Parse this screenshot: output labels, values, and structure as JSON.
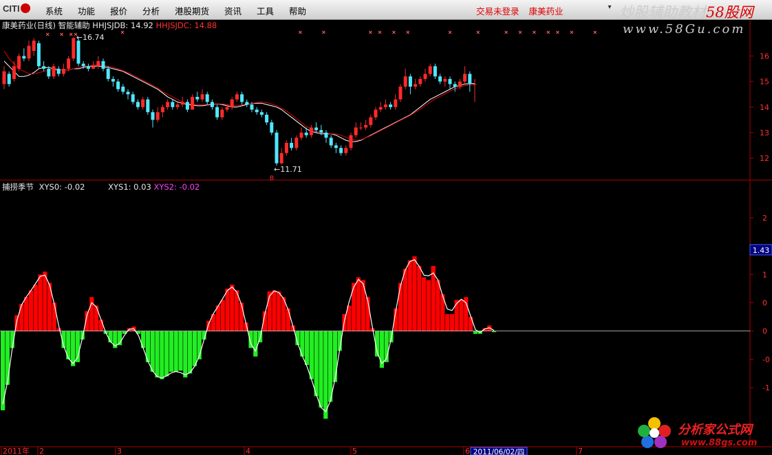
{
  "menubar": {
    "logo_text": "CITI",
    "items": [
      "系统",
      "功能",
      "报价",
      "分析",
      "港股期货",
      "资讯",
      "工具",
      "帮助"
    ],
    "status_login": "交易未登录",
    "status_stock": "康美药业",
    "minimize_label": "▾"
  },
  "watermarks": {
    "top_main": "炒股辅助教材",
    "top_accent": "58股网",
    "top_url": "www.58Gu.com",
    "bottom_main": "分析家公式网",
    "bottom_url": "www.88gs.com"
  },
  "price_panel": {
    "title": "康美药业(日线) 智能辅助",
    "line1_label": "HHJSJDB: 14.92",
    "line2_label": "HHJSJDC: 14.88",
    "high_label": "16.74",
    "low_label": "11.71",
    "low_mark": "B",
    "colors": {
      "up": "#ff2a2a",
      "down": "#50e8ff",
      "line1": "#ffffff",
      "line2": "#e00000"
    }
  },
  "indicator_panel": {
    "title": "捕捞季节",
    "xys0_label": "XYS0: -0.02",
    "xys1_label": "XYS1: 0.03",
    "xys2_label": "XYS2: -0.02",
    "cursor_value": "1.43",
    "colors": {
      "pos": "#ff0000",
      "neg": "#22ee22"
    }
  },
  "x_axis": {
    "labels": [
      "2011年",
      "2",
      "3",
      "4",
      "5",
      "6",
      "7"
    ],
    "cursor_date": "2011/06/02/四"
  },
  "chart_data": [
    {
      "type": "candlestick",
      "title": "康美药业(日线) 智能辅助",
      "y_ticks": [
        "16",
        "15",
        "14",
        "13",
        "12"
      ],
      "ylim": [
        11.6,
        16.9
      ],
      "series": [
        {
          "name": "HHJSJDB",
          "values": [
            15.8,
            15.6,
            15.4,
            15.2,
            15.2,
            15.25,
            15.35,
            15.5,
            15.55,
            15.55,
            15.5,
            15.45,
            15.45,
            15.45,
            15.5,
            15.5,
            15.55,
            15.6,
            15.6,
            15.6,
            15.58,
            15.55,
            15.5,
            15.45,
            15.4,
            15.3,
            15.2,
            15.1,
            15.0,
            14.9,
            14.8,
            14.7,
            14.55,
            14.4,
            14.3,
            14.2,
            14.15,
            14.1,
            14.08,
            14.05,
            14.05,
            14.08,
            14.1,
            14.12,
            14.1,
            14.05,
            14.0,
            14.0,
            14.05,
            14.1,
            14.15,
            14.15,
            14.15,
            14.1,
            14.05,
            14.0,
            13.9,
            13.75,
            13.6,
            13.45,
            13.3,
            13.15,
            13.05,
            13.0,
            12.95,
            12.95,
            12.95,
            12.9,
            12.8,
            12.7,
            12.65,
            12.65,
            12.7,
            12.8,
            12.9,
            13.0,
            13.1,
            13.2,
            13.3,
            13.4,
            13.5,
            13.6,
            13.7,
            13.85,
            14.0,
            14.15,
            14.3,
            14.4,
            14.5,
            14.6,
            14.7,
            14.8,
            14.85,
            14.9,
            14.92,
            14.92
          ]
        },
        {
          "name": "HHJSJDC",
          "values": [
            16.2,
            15.9,
            15.7,
            15.5,
            15.4,
            15.3,
            15.3,
            15.35,
            15.4,
            15.45,
            15.45,
            15.45,
            15.45,
            15.45,
            15.5,
            15.55,
            15.6,
            15.6,
            15.65,
            15.65,
            15.62,
            15.6,
            15.55,
            15.5,
            15.42,
            15.35,
            15.25,
            15.15,
            15.05,
            14.95,
            14.85,
            14.75,
            14.6,
            14.5,
            14.4,
            14.3,
            14.2,
            14.15,
            14.1,
            14.1,
            14.1,
            14.1,
            14.12,
            14.12,
            14.12,
            14.1,
            14.05,
            14.05,
            14.08,
            14.12,
            14.15,
            14.18,
            14.2,
            14.18,
            14.12,
            14.05,
            13.95,
            13.85,
            13.7,
            13.55,
            13.4,
            13.25,
            13.15,
            13.05,
            13.0,
            12.98,
            12.95,
            12.95,
            12.9,
            12.82,
            12.75,
            12.7,
            12.72,
            12.8,
            12.88,
            12.98,
            13.08,
            13.18,
            13.28,
            13.38,
            13.48,
            13.58,
            13.68,
            13.8,
            13.92,
            14.05,
            14.2,
            14.32,
            14.42,
            14.52,
            14.62,
            14.72,
            14.78,
            14.84,
            14.87,
            14.88
          ]
        }
      ],
      "candles": [
        [
          14.9,
          15.4,
          15.6,
          14.7
        ],
        [
          15.3,
          14.9,
          15.4,
          14.8
        ],
        [
          15.1,
          15.6,
          15.8,
          15.0
        ],
        [
          15.5,
          16.0,
          16.1,
          15.4
        ],
        [
          16.0,
          15.9,
          16.3,
          15.8
        ],
        [
          15.9,
          16.4,
          16.6,
          15.8
        ],
        [
          16.2,
          16.6,
          16.7,
          16.0
        ],
        [
          16.5,
          15.6,
          16.6,
          15.5
        ],
        [
          15.6,
          15.5,
          15.8,
          15.4
        ],
        [
          15.5,
          15.2,
          15.6,
          15.1
        ],
        [
          15.2,
          15.6,
          15.7,
          15.1
        ],
        [
          15.5,
          15.3,
          15.6,
          15.2
        ],
        [
          15.3,
          15.5,
          15.7,
          15.2
        ],
        [
          15.5,
          15.9,
          16.0,
          15.4
        ],
        [
          15.9,
          16.7,
          16.74,
          15.8
        ],
        [
          16.6,
          15.7,
          16.7,
          15.6
        ],
        [
          15.7,
          15.6,
          15.8,
          15.5
        ],
        [
          15.6,
          15.5,
          15.7,
          15.4
        ],
        [
          15.5,
          15.6,
          15.8,
          15.5
        ],
        [
          15.6,
          15.8,
          16.0,
          15.5
        ],
        [
          15.8,
          15.5,
          15.9,
          15.4
        ],
        [
          15.5,
          15.1,
          15.6,
          15.0
        ],
        [
          15.1,
          15.0,
          15.2,
          14.8
        ],
        [
          15.0,
          14.7,
          15.1,
          14.6
        ],
        [
          14.8,
          14.6,
          14.9,
          14.5
        ],
        [
          14.6,
          14.5,
          14.7,
          14.3
        ],
        [
          14.5,
          14.2,
          14.6,
          14.1
        ],
        [
          14.2,
          14.0,
          14.3,
          13.9
        ],
        [
          14.0,
          14.3,
          14.4,
          13.9
        ],
        [
          14.3,
          13.8,
          14.4,
          13.7
        ],
        [
          13.8,
          13.5,
          13.9,
          13.2
        ],
        [
          13.5,
          13.8,
          14.0,
          13.4
        ],
        [
          13.8,
          14.0,
          14.1,
          13.6
        ],
        [
          14.0,
          14.2,
          14.3,
          13.9
        ],
        [
          14.2,
          14.0,
          14.3,
          13.9
        ],
        [
          14.0,
          14.1,
          14.2,
          13.9
        ],
        [
          14.1,
          14.2,
          14.4,
          14.0
        ],
        [
          14.2,
          13.9,
          14.3,
          13.8
        ],
        [
          13.9,
          14.4,
          14.5,
          13.9
        ],
        [
          14.4,
          14.3,
          14.6,
          14.2
        ],
        [
          14.3,
          14.5,
          14.7,
          14.2
        ],
        [
          14.5,
          14.2,
          14.6,
          14.1
        ],
        [
          14.2,
          14.0,
          14.3,
          13.9
        ],
        [
          14.0,
          13.6,
          14.1,
          13.5
        ],
        [
          13.6,
          13.9,
          14.0,
          13.5
        ],
        [
          13.9,
          14.0,
          14.1,
          13.8
        ],
        [
          14.0,
          14.3,
          14.4,
          13.9
        ],
        [
          14.3,
          14.5,
          14.6,
          14.2
        ],
        [
          14.5,
          14.2,
          14.6,
          14.1
        ],
        [
          14.2,
          14.1,
          14.3,
          14.0
        ],
        [
          14.1,
          13.9,
          14.2,
          13.8
        ],
        [
          13.9,
          13.8,
          14.0,
          13.7
        ],
        [
          13.8,
          13.7,
          13.9,
          13.6
        ],
        [
          13.7,
          13.4,
          13.8,
          13.3
        ],
        [
          13.4,
          13.0,
          13.5,
          12.9
        ],
        [
          13.0,
          11.8,
          13.1,
          11.71
        ],
        [
          11.8,
          12.2,
          12.4,
          11.75
        ],
        [
          12.2,
          12.6,
          12.7,
          12.1
        ],
        [
          12.6,
          12.4,
          12.8,
          12.3
        ],
        [
          12.4,
          12.8,
          12.9,
          12.3
        ],
        [
          12.8,
          13.0,
          13.2,
          12.7
        ],
        [
          13.0,
          12.9,
          13.2,
          12.8
        ],
        [
          12.9,
          13.2,
          13.3,
          12.8
        ],
        [
          13.2,
          13.1,
          13.4,
          13.0
        ],
        [
          13.1,
          13.0,
          13.3,
          12.9
        ],
        [
          13.0,
          12.8,
          13.1,
          12.6
        ],
        [
          12.8,
          12.5,
          12.9,
          12.4
        ],
        [
          12.5,
          12.4,
          12.6,
          12.2
        ],
        [
          12.4,
          12.2,
          12.5,
          12.1
        ],
        [
          12.2,
          12.4,
          12.5,
          12.1
        ],
        [
          12.4,
          12.9,
          13.0,
          12.3
        ],
        [
          12.9,
          13.2,
          13.4,
          12.8
        ],
        [
          13.2,
          13.2,
          13.4,
          13.1
        ],
        [
          13.2,
          13.3,
          13.5,
          13.1
        ],
        [
          13.3,
          13.6,
          13.7,
          13.2
        ],
        [
          13.6,
          13.9,
          14.0,
          13.5
        ],
        [
          13.9,
          14.0,
          14.2,
          13.8
        ],
        [
          14.0,
          14.1,
          14.3,
          13.9
        ],
        [
          14.1,
          14.0,
          14.2,
          13.9
        ],
        [
          14.0,
          14.3,
          14.5,
          13.9
        ],
        [
          14.3,
          14.8,
          14.9,
          14.2
        ],
        [
          14.8,
          15.2,
          15.5,
          14.7
        ],
        [
          15.2,
          14.8,
          15.3,
          14.5
        ],
        [
          14.8,
          14.9,
          15.1,
          14.7
        ],
        [
          14.9,
          15.1,
          15.2,
          14.8
        ],
        [
          15.1,
          15.3,
          15.5,
          15.0
        ],
        [
          15.3,
          15.6,
          15.7,
          15.2
        ],
        [
          15.6,
          15.2,
          15.7,
          15.1
        ],
        [
          15.2,
          15.0,
          15.3,
          14.9
        ],
        [
          15.0,
          15.1,
          15.2,
          14.8
        ],
        [
          15.1,
          14.9,
          15.2,
          14.7
        ],
        [
          14.9,
          14.8,
          15.0,
          14.6
        ],
        [
          14.8,
          15.0,
          15.1,
          14.7
        ],
        [
          15.0,
          15.3,
          15.6,
          14.9
        ],
        [
          15.3,
          14.9,
          15.4,
          14.6
        ],
        [
          14.9,
          14.9,
          15.1,
          14.2
        ]
      ]
    },
    {
      "type": "bar",
      "title": "捕捞季节",
      "y_ticks": [
        "2",
        "1",
        "0",
        "-0",
        "-1"
      ],
      "ylim": [
        -1.68,
        2.4
      ],
      "values": [
        -1.4,
        -0.95,
        -0.3,
        0.28,
        0.48,
        0.6,
        0.72,
        0.82,
        1.0,
        1.05,
        0.85,
        0.5,
        0.05,
        -0.3,
        -0.5,
        -0.62,
        -0.55,
        -0.15,
        0.35,
        0.6,
        0.45,
        0.2,
        -0.05,
        -0.2,
        -0.3,
        -0.25,
        -0.05,
        0.05,
        0.08,
        -0.05,
        -0.3,
        -0.55,
        -0.72,
        -0.82,
        -0.85,
        -0.8,
        -0.72,
        -0.72,
        -0.7,
        -0.82,
        -0.75,
        -0.62,
        -0.5,
        -0.15,
        0.18,
        0.3,
        0.45,
        0.55,
        0.75,
        0.82,
        0.72,
        0.5,
        0.15,
        -0.3,
        -0.45,
        -0.2,
        0.35,
        0.7,
        0.72,
        0.7,
        0.6,
        0.4,
        0.1,
        -0.25,
        -0.45,
        -0.6,
        -0.85,
        -1.15,
        -1.35,
        -1.55,
        -1.25,
        -0.9,
        -0.35,
        0.3,
        0.45,
        0.85,
        0.95,
        0.9,
        0.6,
        0.05,
        -0.45,
        -0.65,
        -0.55,
        -0.2,
        0.4,
        0.85,
        1.1,
        1.25,
        1.32,
        1.15,
        0.95,
        0.9,
        1.15,
        0.9,
        0.65,
        0.3,
        0.3,
        0.55,
        0.55,
        0.6,
        0.25,
        -0.05,
        -0.05,
        0.05,
        0.1,
        -0.02
      ]
    }
  ]
}
